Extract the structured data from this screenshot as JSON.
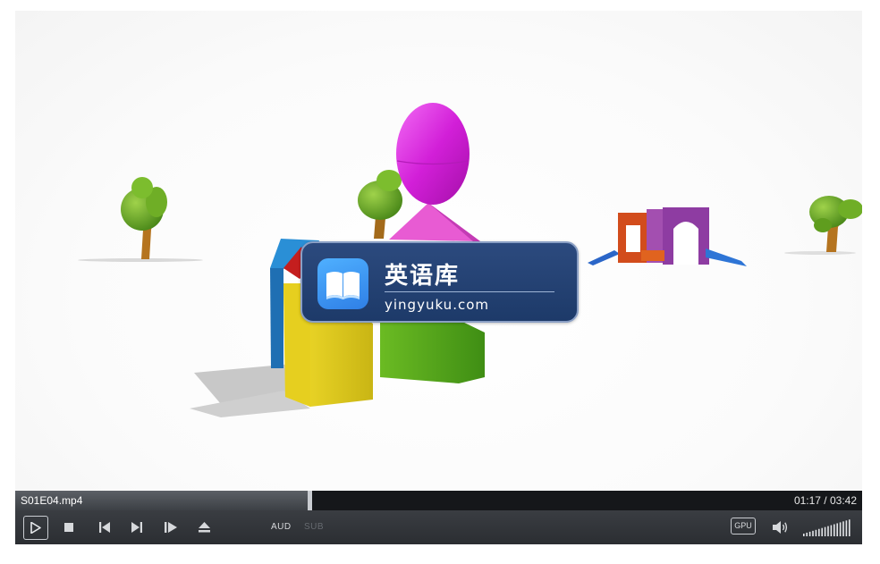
{
  "watermark": {
    "title": "英语库",
    "url": "yingyuku.com",
    "logo_icon": "open-book-icon",
    "bg_color": "#1d3a69"
  },
  "player": {
    "file_name": "S01E04.mp4",
    "time_display": "01:17 / 03:42",
    "progress_fraction": 0.347,
    "buttons": {
      "play_icon": "play-icon",
      "stop_icon": "stop-icon",
      "prev_icon": "skip-previous-icon",
      "next_icon": "skip-next-icon",
      "frame_step_icon": "frame-step-icon",
      "eject_icon": "eject-icon",
      "audio_label": "AUD",
      "subtitle_label": "SUB",
      "gpu_label": "GPU",
      "speaker_icon": "speaker-icon"
    },
    "volume_fraction": 1.0,
    "colors": {
      "bar_bg": "#2a2d31",
      "seek_bg": "#15171a",
      "text": "#ffffff",
      "disabled_text": "#666a70"
    }
  }
}
